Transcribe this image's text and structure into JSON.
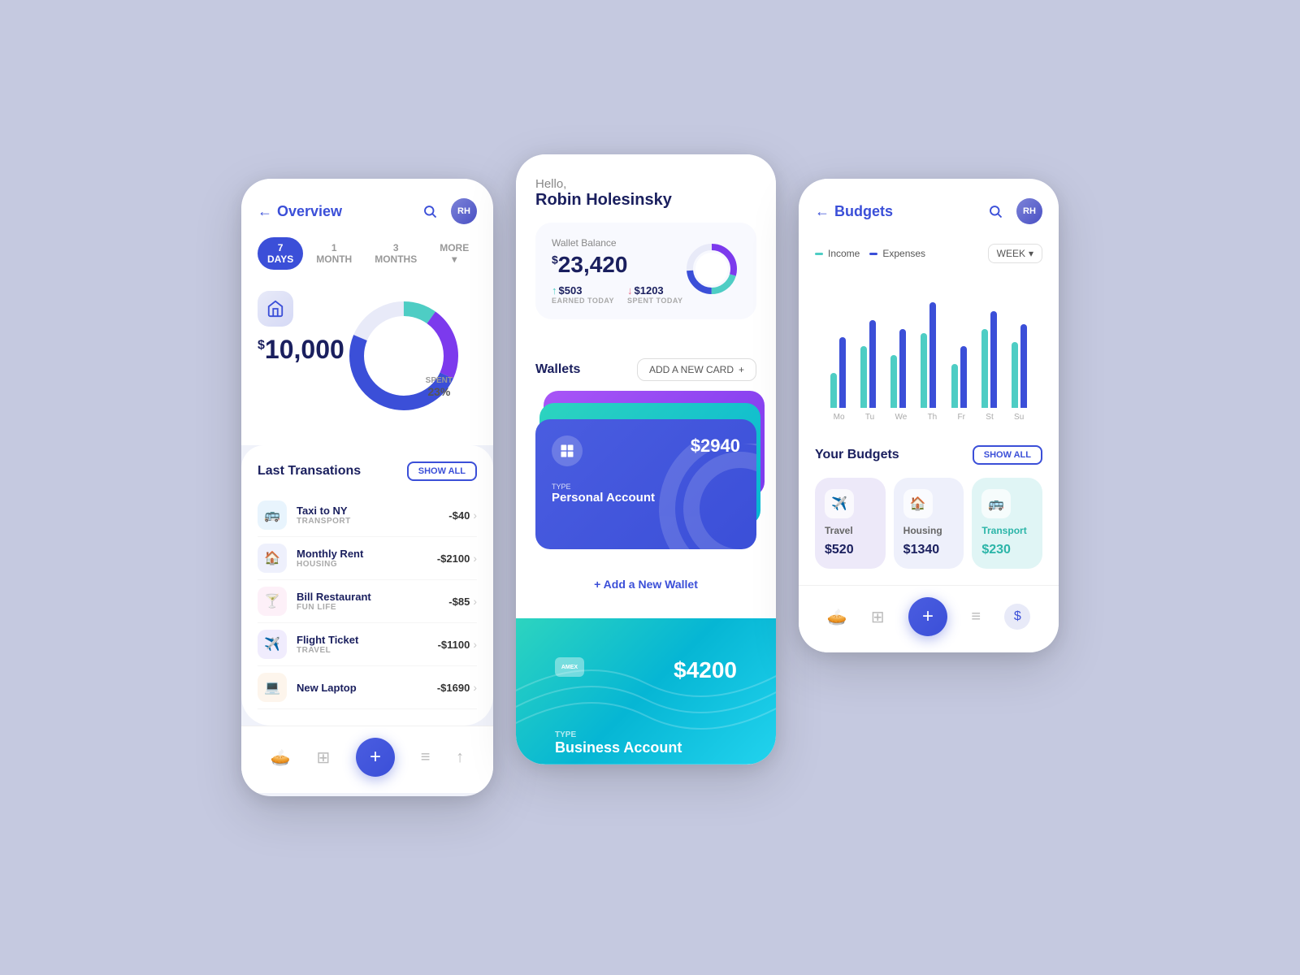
{
  "app": {
    "bg_color": "#c5c9e0"
  },
  "left_screen": {
    "title": "Overview",
    "filters": [
      "7 DAYS",
      "1 MONTH",
      "3 MONTHS",
      "MORE ▾"
    ],
    "active_filter": "7 DAYS",
    "amount": "10,000",
    "spent_pct": "23%",
    "spent_label": "SPENT",
    "transactions_title": "Last Transations",
    "show_all": "SHOW ALL",
    "transactions": [
      {
        "name": "Taxi to NY",
        "category": "TRANSPORT",
        "amount": "-$40",
        "icon": "🚌"
      },
      {
        "name": "Monthly Rent",
        "category": "HOUSING",
        "amount": "-$2100",
        "icon": "🏠"
      },
      {
        "name": "Bill Restaurant",
        "category": "FUN LIFE",
        "amount": "-$85",
        "icon": "🍸"
      },
      {
        "name": "Flight Ticket",
        "category": "TRAVEL",
        "amount": "-$1100",
        "icon": "✈️"
      },
      {
        "name": "New Laptop",
        "category": "",
        "amount": "-$1690",
        "icon": "💻"
      }
    ]
  },
  "middle_screen": {
    "greeting": "Hello,",
    "user_name": "Robin Holesinsky",
    "balance_label": "Wallet Balance",
    "balance_amount": "23,420",
    "earned_val": "$503",
    "earned_label": "EARNED TODAY",
    "spent_val": "$1203",
    "spent_label": "SPENT TODAY",
    "wallets_title": "Wallets",
    "add_card_btn": "ADD A NEW CARD",
    "cards": [
      {
        "amount": "$4200",
        "type": "TYPE",
        "name": "Business Account",
        "color": "teal"
      },
      {
        "amount": "$2940",
        "type": "TYPE",
        "name": "Personal Account",
        "color": "blue"
      }
    ],
    "add_wallet": "+ Add a New Wallet",
    "large_card_amount": "$4200",
    "large_card_type": "TYPE",
    "large_card_name": "Business Account"
  },
  "right_screen": {
    "title": "Budgets",
    "legend_income": "Income",
    "legend_expense": "Expenses",
    "week_label": "WEEK",
    "bar_days": [
      "Mo",
      "Tu",
      "We",
      "Th",
      "Fr",
      "St",
      "Su"
    ],
    "bars": [
      {
        "income": 40,
        "expense": 80
      },
      {
        "income": 70,
        "expense": 100
      },
      {
        "income": 60,
        "expense": 90
      },
      {
        "income": 85,
        "expense": 120
      },
      {
        "income": 50,
        "expense": 70
      },
      {
        "income": 90,
        "expense": 110
      },
      {
        "income": 75,
        "expense": 95
      }
    ],
    "your_budgets": "Your Budgets",
    "show_all": "SHOW ALL",
    "budget_cards": [
      {
        "category": "Travel",
        "amount": "$520",
        "type": "travel",
        "icon": "✈️"
      },
      {
        "category": "Housing",
        "amount": "$1340",
        "type": "housing",
        "icon": "🏠"
      },
      {
        "category": "Transport",
        "amount": "$230",
        "type": "transport",
        "icon": "🚌"
      }
    ]
  }
}
